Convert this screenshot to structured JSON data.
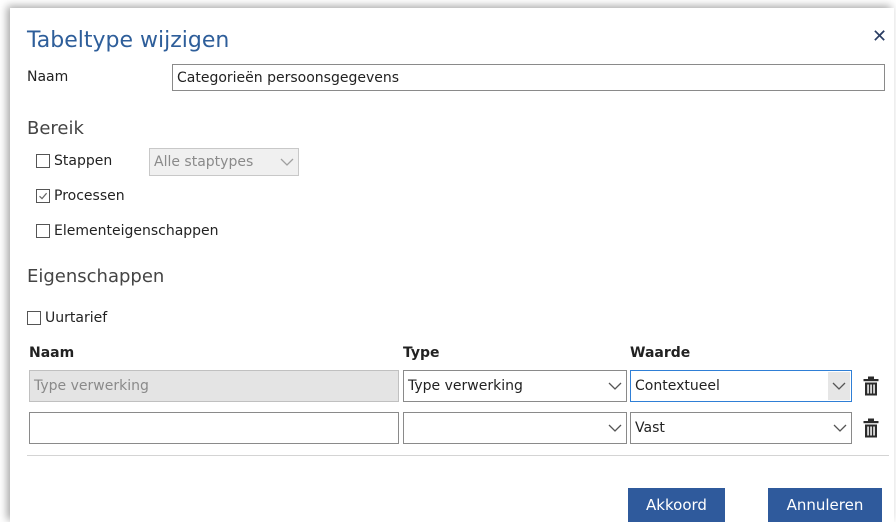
{
  "dialog": {
    "title": "Tabeltype wijzigen",
    "close_icon": "close-icon",
    "name_label": "Naam",
    "name_value": "Categorieën persoonsgegevens"
  },
  "bereik": {
    "heading": "Bereik",
    "stappen": {
      "label": "Stappen",
      "checked": false
    },
    "staptypes_select": "Alle staptypes",
    "processen": {
      "label": "Processen",
      "checked": true
    },
    "elementeigenschappen": {
      "label": "Elementeigenschappen",
      "checked": false
    }
  },
  "eigenschappen": {
    "heading": "Eigenschappen",
    "uurtarief": {
      "label": "Uurtarief",
      "checked": false
    },
    "columns": {
      "naam": "Naam",
      "type": "Type",
      "waarde": "Waarde"
    },
    "rows": [
      {
        "naam": "Type verwerking",
        "type": "Type verwerking",
        "waarde": "Contextueel"
      },
      {
        "naam": "",
        "type": "",
        "waarde": "Vast"
      }
    ]
  },
  "buttons": {
    "ok": "Akkoord",
    "cancel": "Annuleren"
  },
  "colors": {
    "accent": "#2f5a9c",
    "title": "#2e5e9a",
    "focus": "#2f7fd6"
  }
}
